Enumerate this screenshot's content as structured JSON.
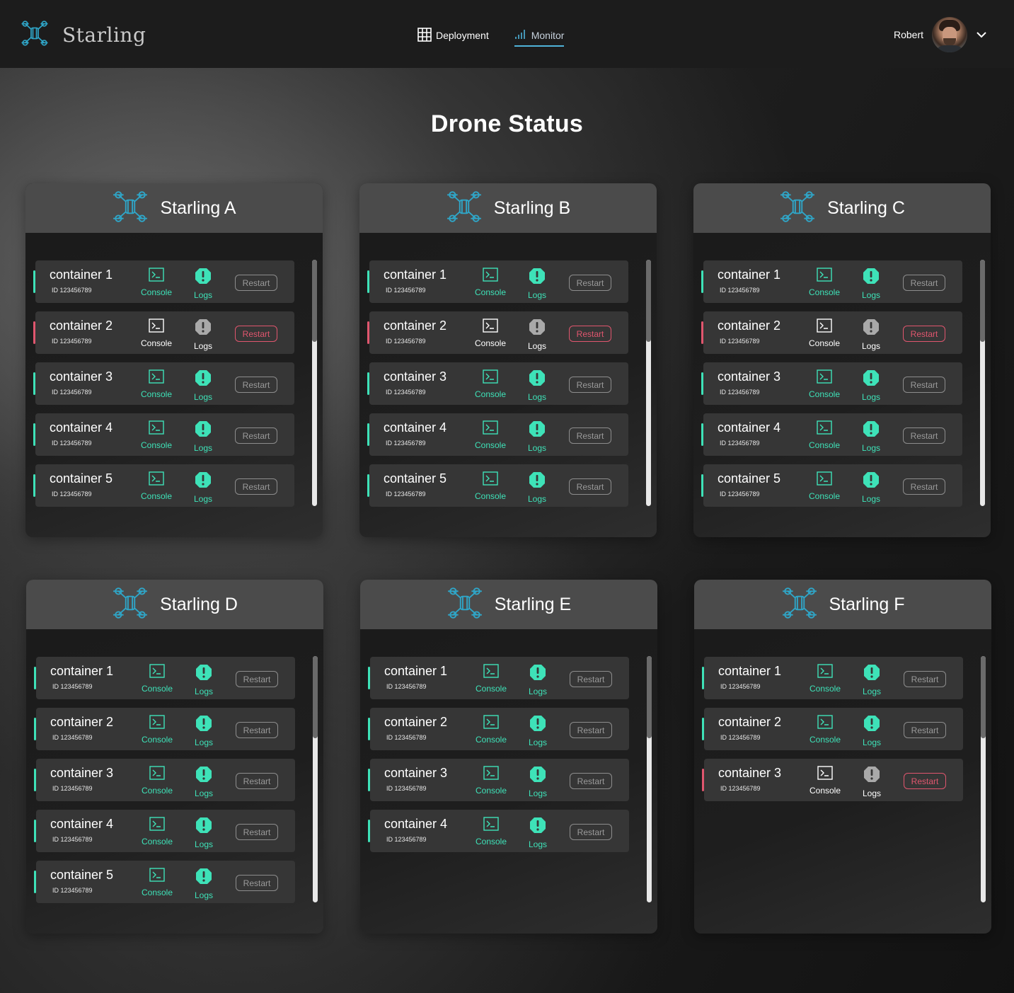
{
  "app": {
    "name": "Starling"
  },
  "nav": {
    "deployment": "Deployment",
    "monitor": "Monitor"
  },
  "user": {
    "name": "Robert"
  },
  "page": {
    "title": "Drone Status"
  },
  "colors": {
    "accent": "#3ee2b8",
    "error": "#e0566e",
    "drone_icon": "#2fa6c8"
  },
  "labels": {
    "console": "Console",
    "logs": "Logs",
    "restart": "Restart"
  },
  "drones": [
    {
      "name": "Starling A",
      "containers": [
        {
          "name": "container 1",
          "id": "ID 123456789",
          "status": "ok"
        },
        {
          "name": "container 2",
          "id": "ID 123456789",
          "status": "error"
        },
        {
          "name": "container 3",
          "id": "ID 123456789",
          "status": "ok"
        },
        {
          "name": "container 4",
          "id": "ID 123456789",
          "status": "ok"
        },
        {
          "name": "container 5",
          "id": "ID 123456789",
          "status": "ok"
        }
      ]
    },
    {
      "name": "Starling B",
      "containers": [
        {
          "name": "container 1",
          "id": "ID 123456789",
          "status": "ok"
        },
        {
          "name": "container 2",
          "id": "ID 123456789",
          "status": "error"
        },
        {
          "name": "container 3",
          "id": "ID 123456789",
          "status": "ok"
        },
        {
          "name": "container 4",
          "id": "ID 123456789",
          "status": "ok"
        },
        {
          "name": "container 5",
          "id": "ID 123456789",
          "status": "ok"
        }
      ]
    },
    {
      "name": "Starling C",
      "containers": [
        {
          "name": "container 1",
          "id": "ID 123456789",
          "status": "ok"
        },
        {
          "name": "container 2",
          "id": "ID 123456789",
          "status": "error"
        },
        {
          "name": "container 3",
          "id": "ID 123456789",
          "status": "ok"
        },
        {
          "name": "container 4",
          "id": "ID 123456789",
          "status": "ok"
        },
        {
          "name": "container 5",
          "id": "ID 123456789",
          "status": "ok"
        }
      ]
    },
    {
      "name": "Starling D",
      "containers": [
        {
          "name": "container 1",
          "id": "ID 123456789",
          "status": "ok"
        },
        {
          "name": "container 2",
          "id": "ID 123456789",
          "status": "ok"
        },
        {
          "name": "container 3",
          "id": "ID 123456789",
          "status": "ok"
        },
        {
          "name": "container 4",
          "id": "ID 123456789",
          "status": "ok"
        },
        {
          "name": "container 5",
          "id": "ID 123456789",
          "status": "ok"
        }
      ]
    },
    {
      "name": "Starling E",
      "containers": [
        {
          "name": "container 1",
          "id": "ID 123456789",
          "status": "ok"
        },
        {
          "name": "container 2",
          "id": "ID 123456789",
          "status": "ok"
        },
        {
          "name": "container 3",
          "id": "ID 123456789",
          "status": "ok"
        },
        {
          "name": "container 4",
          "id": "ID 123456789",
          "status": "ok"
        }
      ]
    },
    {
      "name": "Starling F",
      "containers": [
        {
          "name": "container 1",
          "id": "ID 123456789",
          "status": "ok"
        },
        {
          "name": "container 2",
          "id": "ID 123456789",
          "status": "ok"
        },
        {
          "name": "container 3",
          "id": "ID 123456789",
          "status": "error"
        }
      ]
    }
  ]
}
